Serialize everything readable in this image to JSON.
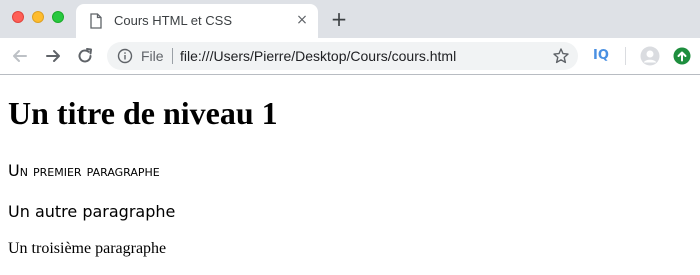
{
  "browser": {
    "window_controls": [
      "close",
      "minimize",
      "zoom"
    ],
    "tab": {
      "title": "Cours HTML et CSS",
      "icon": "document-icon",
      "close": "×"
    },
    "new_tab": "+",
    "toolbar": {
      "back_icon": "arrow-left-icon",
      "forward_icon": "arrow-right-icon",
      "reload_icon": "reload-icon"
    },
    "omnibox": {
      "scheme_label": "File",
      "url": "file:///Users/Pierre/Desktop/Cours/cours.html",
      "info_icon": "info-icon",
      "bookmark_icon": "star-icon"
    },
    "extensions": {
      "iq_label": "IQ",
      "profile_icon": "profile-avatar-icon",
      "update_icon": "update-arrow-icon"
    }
  },
  "page": {
    "heading": "Un titre de niveau 1",
    "paragraphs": [
      "Un premier paragraphe",
      "Un autre paragraphe",
      "Un troisième paragraphe"
    ]
  },
  "colors": {
    "tab_bar": "#dee1e6",
    "omnibox": "#f1f3f4",
    "iq_blue": "#4a90e2",
    "update_green": "#1e8e3e"
  }
}
